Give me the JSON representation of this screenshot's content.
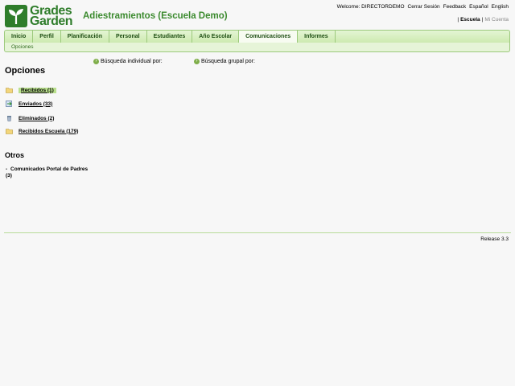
{
  "brand": {
    "logo_line1": "Grades",
    "logo_line2": "Garden"
  },
  "school_title": "Adiestramientos (Escuela Demo)",
  "topbar": {
    "welcome": "Welcome: DIRECTORDEMO",
    "logout": "Cerrar Sesión",
    "feedback": "Feedback",
    "lang_es": "Español",
    "lang_en": "English"
  },
  "context": {
    "escuela": "Escuela",
    "cuenta": "Mi Cuenta"
  },
  "nav": {
    "tabs": [
      "Inicio",
      "Perfil",
      "Planificación",
      "Personal",
      "Estudiantes",
      "Año Escolar",
      "Comunicaciones",
      "Informes"
    ],
    "active_index": 6
  },
  "subnav": {
    "label": "Opciones"
  },
  "search": {
    "individual": "Búsqueda individual por:",
    "grupal": "Búsqueda grupal por:"
  },
  "opciones": {
    "title": "Opciones",
    "items": [
      {
        "label": "Recibidos (1)",
        "icon": "folder-icon"
      },
      {
        "label": "Enviados (33)",
        "icon": "sent-icon"
      },
      {
        "label": "Eliminados (2)",
        "icon": "trash-icon"
      },
      {
        "label": "Recibidos Escuela (179)",
        "icon": "folder-icon"
      }
    ]
  },
  "otros": {
    "title": "Otros",
    "items": [
      {
        "label": "Comunicados Portal de Padres (3)"
      }
    ]
  },
  "footer": {
    "release": "Release 3.3"
  },
  "colors": {
    "brand_green": "#2f7d2b",
    "nav_bg": "#cdeab0",
    "selected": "#b9e08c"
  }
}
